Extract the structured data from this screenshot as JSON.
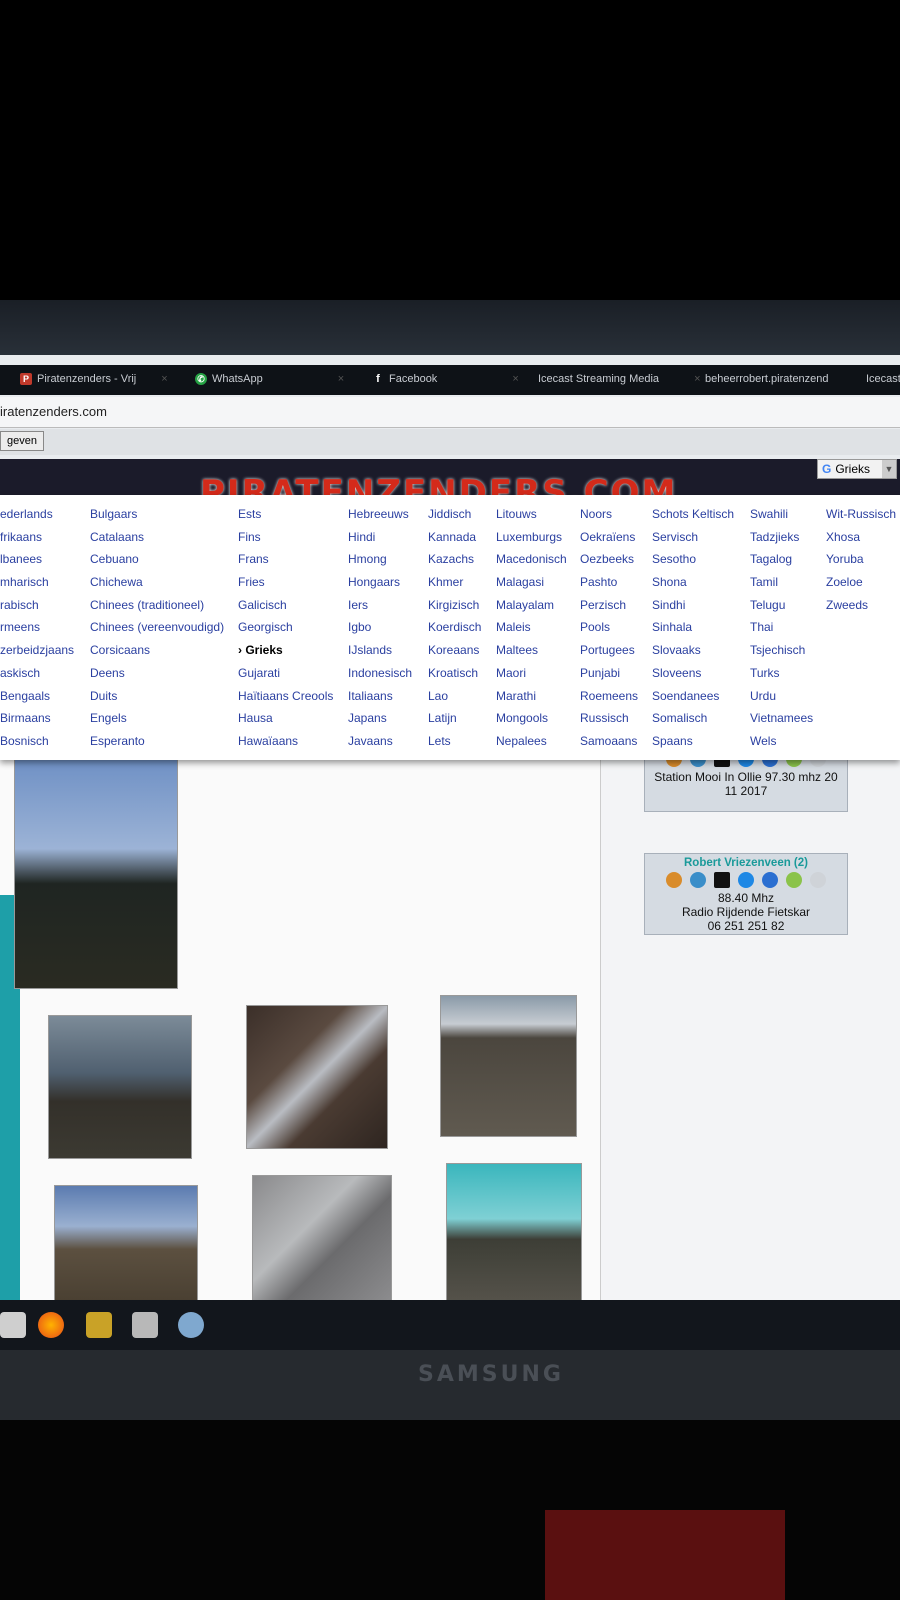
{
  "browser": {
    "tabs": [
      {
        "label": "Piratenzenders - Vrij",
        "icon": "p-icon",
        "close": "×"
      },
      {
        "label": "WhatsApp",
        "icon": "whatsapp-icon",
        "close": "×"
      },
      {
        "label": "Facebook",
        "icon": "facebook-icon",
        "close": "×"
      },
      {
        "label": "Icecast Streaming Media",
        "close": "×"
      },
      {
        "label": "beheerrobert.piratenzend"
      },
      {
        "label": "Icecast"
      }
    ],
    "url": "iratenzenders.com",
    "button_label": "geven"
  },
  "site": {
    "logo_text": "PIRATENZENDERS.COM",
    "language_select": {
      "selected": "Grieks",
      "caret": "▼"
    },
    "languages": [
      [
        "ederlands",
        "frikaans",
        "lbanees",
        "mharisch",
        "rabisch",
        "rmeens",
        "zerbeidzjaans",
        "askisch",
        "Bengaals",
        "Birmaans",
        "Bosnisch"
      ],
      [
        "Bulgaars",
        "Catalaans",
        "Cebuano",
        "Chichewa",
        "Chinees (traditioneel)",
        "Chinees (vereenvoudigd)",
        "Corsicaans",
        "Deens",
        "Duits",
        "Engels",
        "Esperanto"
      ],
      [
        "Ests",
        "Fins",
        "Frans",
        "Fries",
        "Galicisch",
        "Georgisch",
        "› Grieks",
        "Gujarati",
        "Haïtiaans Creools",
        "Hausa",
        "Hawaïaans"
      ],
      [
        "Hebreeuws",
        "Hindi",
        "Hmong",
        "Hongaars",
        "Iers",
        "Igbo",
        "IJslands",
        "Indonesisch",
        "Italiaans",
        "Japans",
        "Javaans"
      ],
      [
        "Jiddisch",
        "Kannada",
        "Kazachs",
        "Khmer",
        "Kirgizisch",
        "Koerdisch",
        "Koreaans",
        "Kroatisch",
        "Lao",
        "Latijn",
        "Lets"
      ],
      [
        "Litouws",
        "Luxemburgs",
        "Macedonisch",
        "Malagasi",
        "Malayalam",
        "Maleis",
        "Maltees",
        "Maori",
        "Marathi",
        "Mongools",
        "Nepalees"
      ],
      [
        "Noors",
        "Oekraïens",
        "Oezbeeks",
        "Pashto",
        "Perzisch",
        "Pools",
        "Portugees",
        "Punjabi",
        "Roemeens",
        "Russisch",
        "Samoaans"
      ],
      [
        "Schots Keltisch",
        "Servisch",
        "Sesotho",
        "Shona",
        "Sindhi",
        "Sinhala",
        "Slovaaks",
        "Sloveens",
        "Soendanees",
        "Somalisch",
        "Spaans"
      ],
      [
        "Swahili",
        "Tadzjieks",
        "Tagalog",
        "Tamil",
        "Telugu",
        "Thai",
        "Tsjechisch",
        "Turks",
        "Urdu",
        "Vietnamees",
        "Wels"
      ],
      [
        "Wit-Russisch",
        "Xhosa",
        "Yoruba",
        "Zoeloe",
        "Zweeds"
      ]
    ],
    "stations": [
      {
        "title": "",
        "line1": "Station Mooi In Ollie 97.30 mhz 20",
        "line2": "11 2017",
        "line3": ""
      },
      {
        "title": "Robert Vriezenveen (2)",
        "line1": "88.40 Mhz",
        "line2": "Radio Rijdende Fietskar",
        "line3": "06 251 251 82"
      }
    ]
  },
  "colors": {
    "accent_link": "#2a3fa0",
    "station_title": "#1a9a9a",
    "logo_red": "#d42a1a"
  },
  "taskbar_icons": [
    "explorer-icon",
    "firefox-icon",
    "app-icon",
    "tool-icon",
    "network-icon"
  ],
  "monitor": {
    "brand": "SAMSUNG"
  }
}
